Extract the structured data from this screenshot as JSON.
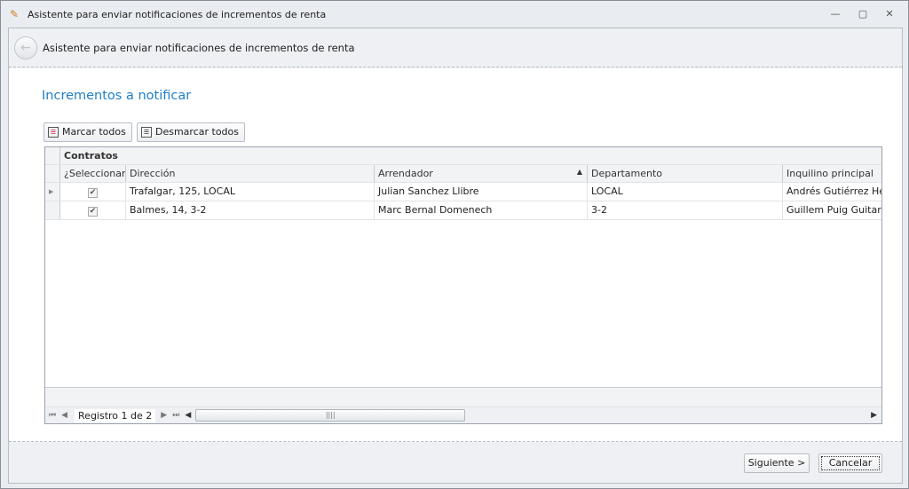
{
  "window": {
    "title": "Asistente para enviar notificaciones de incrementos de renta",
    "minimize": "—",
    "maximize": "▢",
    "close": "✕"
  },
  "header": {
    "title": "Asistente para enviar notificaciones de incrementos de renta"
  },
  "page": {
    "title": "Incrementos a notificar"
  },
  "toolbar": {
    "mark_all": "Marcar todos",
    "unmark_all": "Desmarcar todos"
  },
  "grid": {
    "group": "Contratos",
    "columns": [
      "¿Seleccionar?",
      "Dirección",
      "Arrendador",
      "Departamento",
      "Inquilino principal"
    ],
    "sort": {
      "column": "Arrendador",
      "direction": "ascending"
    },
    "rows": [
      {
        "selected": true,
        "direccion": "Trafalgar, 125, LOCAL",
        "arrendador": "Julian Sanchez Llibre",
        "departamento": "LOCAL",
        "inquilino": "Andrés Gutiérrez Herede"
      },
      {
        "selected": true,
        "direccion": "Balmes, 14, 3-2",
        "arrendador": "Marc Bernal Domenech",
        "departamento": "3-2",
        "inquilino": "Guillem Puig Guitart"
      }
    ],
    "navigator": "Registro 1 de 2"
  },
  "footer": {
    "next": "Siguiente >",
    "cancel": "Cancelar"
  }
}
